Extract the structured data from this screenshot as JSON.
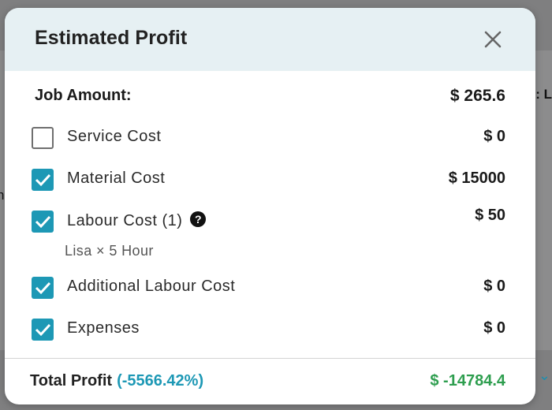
{
  "modal": {
    "title": "Estimated Profit"
  },
  "job": {
    "label": "Job Amount:",
    "value": "$ 265.6"
  },
  "costs": [
    {
      "label": "Service Cost",
      "value": "$ 0",
      "checked": false
    },
    {
      "label": "Material Cost",
      "value": "$ 15000",
      "checked": true
    },
    {
      "label": "Labour Cost (1)",
      "value": "$ 50",
      "checked": true,
      "note": "Lisa × 5 Hour"
    },
    {
      "label": "Additional Labour Cost",
      "value": "$ 0",
      "checked": true
    },
    {
      "label": "Expenses",
      "value": "$ 0",
      "checked": true
    }
  ],
  "total": {
    "label": "Total Profit",
    "percent": "(-5566.42%)",
    "value": "$ -14784.4"
  },
  "background": {
    "right_peek": ": L",
    "left_peek": "n"
  },
  "colors": {
    "accent": "#1d98b5",
    "profit_value": "#2e9e4f",
    "header_bg": "#e6f0f3"
  },
  "icons": {
    "close": "close-icon",
    "help": "help-circle-icon",
    "check": "checkmark-icon",
    "chevron": "chevron-down-icon"
  }
}
